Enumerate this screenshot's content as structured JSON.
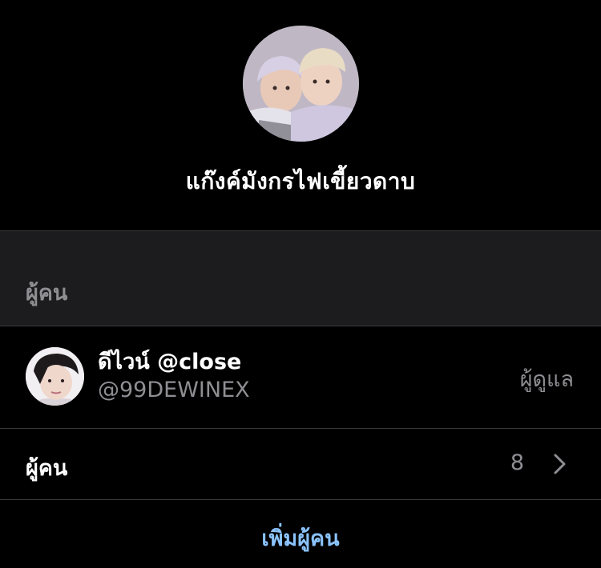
{
  "group": {
    "name": "แก๊งค์มังกรไฟเขี้ยวดาบ",
    "avatar": "group-photo"
  },
  "section": {
    "title": "ผู้คน"
  },
  "member": {
    "name": "ดีไวน์ @close",
    "handle": "@99DEWINEX",
    "role": "ผู้ดูแล",
    "avatar": "member-photo"
  },
  "people_row": {
    "label": "ผู้คน",
    "count": "8",
    "icon": "chevron-right-icon"
  },
  "add_people": {
    "label": "เพิ่มผู้คน"
  },
  "colors": {
    "background": "#000000",
    "section_bg": "#1c1c1e",
    "separator": "#3a3a3c",
    "secondary_text": "#8e8e93",
    "accent": "#8bc3ff"
  }
}
